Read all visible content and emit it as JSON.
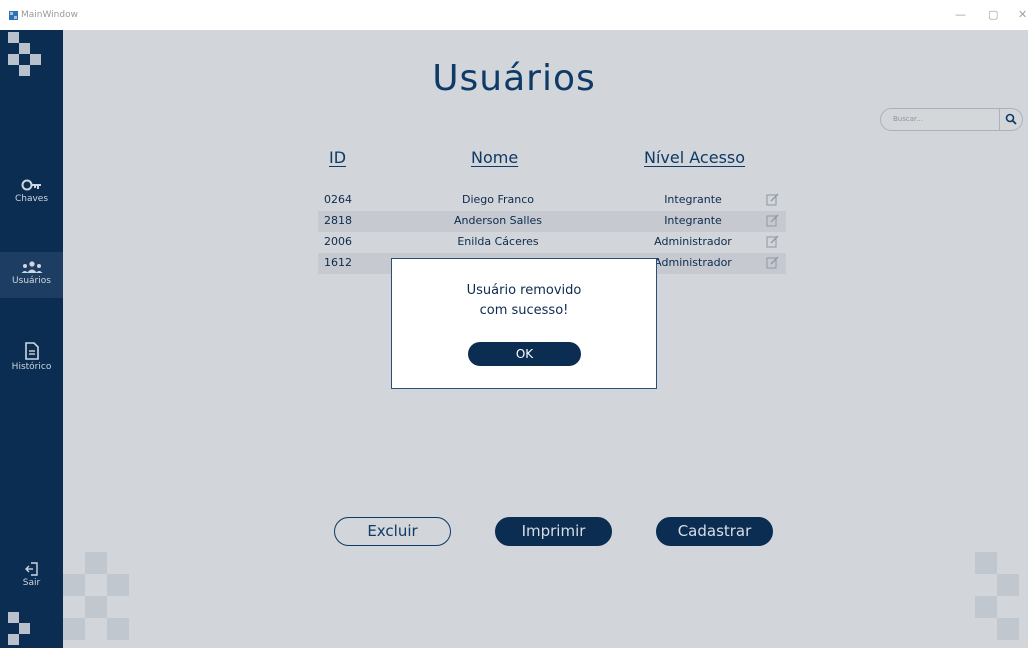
{
  "window": {
    "title": "MainWindow",
    "controls": {
      "minimize": "—",
      "maximize": "▢",
      "close": "✕"
    }
  },
  "sidebar": {
    "items": [
      {
        "label": "Chaves",
        "icon": "key-icon"
      },
      {
        "label": "Usuários",
        "icon": "users-icon",
        "active": true
      },
      {
        "label": "Histórico",
        "icon": "document-icon"
      },
      {
        "label": "Sair",
        "icon": "logout-icon"
      }
    ]
  },
  "page": {
    "title": "Usuários"
  },
  "search": {
    "placeholder": "Buscar..."
  },
  "table": {
    "headers": {
      "id": "ID",
      "name": "Nome",
      "level": "Nível Acesso"
    },
    "rows": [
      {
        "id": "0264",
        "name": "Diego Franco",
        "level": "Integrante"
      },
      {
        "id": "2818",
        "name": "Anderson Salles",
        "level": "Integrante"
      },
      {
        "id": "2006",
        "name": "Enilda Cáceres",
        "level": "Administrador"
      },
      {
        "id": "1612",
        "name": "",
        "level": "Administrador"
      }
    ]
  },
  "actions": {
    "delete": "Excluir",
    "print": "Imprimir",
    "register": "Cadastrar"
  },
  "dialog": {
    "message": "Usuário removido\ncom sucesso!",
    "ok": "OK"
  },
  "colors": {
    "navy": "#0b2d52",
    "accent": "#0d3a66",
    "overlay": "#d2d5d9"
  }
}
